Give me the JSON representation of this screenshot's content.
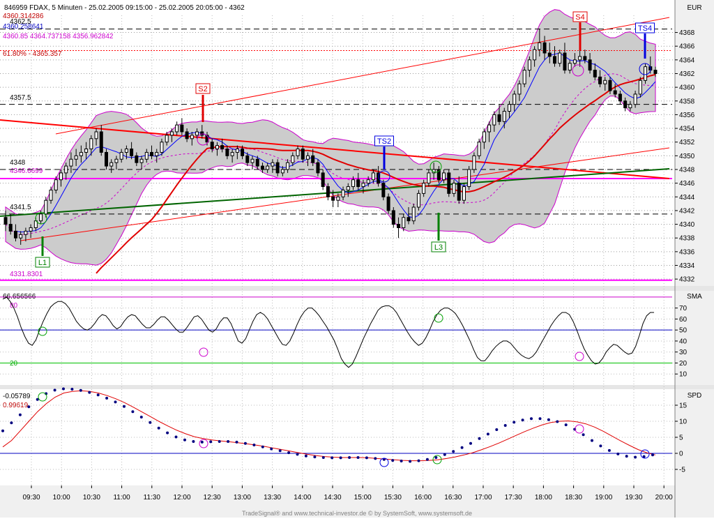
{
  "header": {
    "title": "846959  FDAX, 5 Minuten - 25.02.2005 09:15:00 - 25.02.2005 20:05:00 - 4362",
    "currency": "EUR"
  },
  "colors": {
    "background": "#ffffff",
    "axis_bg": "#f0f0f0",
    "band_fill": "#cccccc",
    "band_line": "#cc00cc",
    "magenta": "#ff00ff",
    "red": "#ff0000",
    "blue": "#0000ff",
    "green": "#006400",
    "navy": "#000080",
    "candle": "#000000"
  },
  "chart_data": [
    {
      "type": "candlestick",
      "panel": "price",
      "y_ticks": [
        4332,
        4334,
        4336,
        4338,
        4340,
        4342,
        4344,
        4346,
        4348,
        4350,
        4352,
        4354,
        4356,
        4358,
        4360,
        4362,
        4364,
        4366,
        4368
      ],
      "ylim": [
        4331.2,
        4370.5
      ],
      "x_ticks": [
        "09:30",
        "10:00",
        "10:30",
        "11:00",
        "11:30",
        "12:00",
        "12:30",
        "13:00",
        "13:30",
        "14:00",
        "14:30",
        "15:00",
        "15:30",
        "16:00",
        "16:30",
        "17:00",
        "17:30",
        "18:00",
        "18:30",
        "19:00",
        "19:30",
        "20:00"
      ],
      "candles": [
        [
          4341.0,
          4342.0,
          4339.0,
          4340.0
        ],
        [
          4340.0,
          4341.5,
          4338.5,
          4339.0
        ],
        [
          4339.0,
          4340.0,
          4337.5,
          4338.0
        ],
        [
          4338.0,
          4339.0,
          4337.0,
          4338.5
        ],
        [
          4338.5,
          4339.5,
          4337.5,
          4339.0
        ],
        [
          4339.0,
          4340.0,
          4338.0,
          4339.5
        ],
        [
          4339.5,
          4341.0,
          4339.0,
          4340.5
        ],
        [
          4340.5,
          4342.0,
          4340.0,
          4341.5
        ],
        [
          4341.5,
          4344.0,
          4341.0,
          4343.5
        ],
        [
          4343.5,
          4345.5,
          4343.0,
          4345.0
        ],
        [
          4345.0,
          4347.0,
          4344.5,
          4346.5
        ],
        [
          4346.5,
          4348.0,
          4345.5,
          4347.5
        ],
        [
          4347.5,
          4349.0,
          4346.5,
          4348.5
        ],
        [
          4348.5,
          4350.5,
          4347.5,
          4349.5
        ],
        [
          4349.5,
          4351.0,
          4348.5,
          4350.0
        ],
        [
          4350.0,
          4351.5,
          4349.0,
          4350.5
        ],
        [
          4350.5,
          4352.0,
          4349.5,
          4351.0
        ],
        [
          4351.0,
          4353.0,
          4350.0,
          4352.5
        ],
        [
          4352.5,
          4354.0,
          4351.5,
          4353.5
        ],
        [
          4353.5,
          4354.5,
          4350.0,
          4350.5
        ],
        [
          4350.5,
          4351.0,
          4348.0,
          4348.5
        ],
        [
          4348.5,
          4349.5,
          4347.5,
          4349.0
        ],
        [
          4349.0,
          4350.0,
          4348.0,
          4349.5
        ],
        [
          4349.5,
          4351.0,
          4349.0,
          4350.5
        ],
        [
          4350.5,
          4351.5,
          4349.5,
          4351.0
        ],
        [
          4351.0,
          4352.0,
          4349.5,
          4350.0
        ],
        [
          4350.0,
          4350.5,
          4348.5,
          4349.0
        ],
        [
          4349.0,
          4350.0,
          4348.0,
          4349.5
        ],
        [
          4349.5,
          4351.0,
          4349.0,
          4350.5
        ],
        [
          4350.5,
          4351.5,
          4349.5,
          4350.0
        ],
        [
          4350.0,
          4351.0,
          4349.0,
          4350.5
        ],
        [
          4350.5,
          4352.5,
          4350.0,
          4352.0
        ],
        [
          4352.0,
          4353.5,
          4351.5,
          4353.0
        ],
        [
          4353.0,
          4354.0,
          4352.0,
          4353.5
        ],
        [
          4353.5,
          4355.0,
          4353.0,
          4354.5
        ],
        [
          4354.5,
          4355.5,
          4353.0,
          4353.5
        ],
        [
          4353.5,
          4354.0,
          4352.0,
          4352.5
        ],
        [
          4352.5,
          4353.5,
          4351.5,
          4353.0
        ],
        [
          4353.0,
          4354.0,
          4352.5,
          4353.5
        ],
        [
          4353.5,
          4354.5,
          4352.5,
          4353.0
        ],
        [
          4353.0,
          4353.5,
          4351.5,
          4352.0
        ],
        [
          4352.0,
          4352.5,
          4350.5,
          4351.0
        ],
        [
          4351.0,
          4352.0,
          4350.0,
          4351.5
        ],
        [
          4351.5,
          4352.5,
          4350.5,
          4351.0
        ],
        [
          4351.0,
          4351.5,
          4349.5,
          4350.0
        ],
        [
          4350.0,
          4351.0,
          4349.0,
          4350.5
        ],
        [
          4350.5,
          4351.5,
          4349.5,
          4351.0
        ],
        [
          4351.0,
          4351.5,
          4349.5,
          4350.0
        ],
        [
          4350.0,
          4350.5,
          4348.5,
          4349.0
        ],
        [
          4349.0,
          4350.0,
          4348.0,
          4349.5
        ],
        [
          4349.5,
          4350.0,
          4348.0,
          4348.5
        ],
        [
          4348.5,
          4349.0,
          4347.5,
          4348.0
        ],
        [
          4348.0,
          4349.0,
          4347.5,
          4348.5
        ],
        [
          4348.5,
          4349.5,
          4347.5,
          4349.0
        ],
        [
          4349.0,
          4349.5,
          4347.0,
          4347.5
        ],
        [
          4347.5,
          4348.5,
          4347.0,
          4348.0
        ],
        [
          4348.0,
          4349.5,
          4347.5,
          4349.0
        ],
        [
          4349.0,
          4350.5,
          4348.5,
          4350.0
        ],
        [
          4350.0,
          4351.5,
          4349.5,
          4351.0
        ],
        [
          4351.0,
          4351.5,
          4349.0,
          4349.5
        ],
        [
          4349.5,
          4350.5,
          4348.5,
          4350.0
        ],
        [
          4350.0,
          4351.0,
          4348.5,
          4349.0
        ],
        [
          4349.0,
          4349.5,
          4347.0,
          4347.5
        ],
        [
          4347.5,
          4348.0,
          4345.0,
          4345.5
        ],
        [
          4345.5,
          4346.0,
          4343.5,
          4344.0
        ],
        [
          4344.0,
          4345.0,
          4342.5,
          4343.5
        ],
        [
          4343.5,
          4344.5,
          4342.5,
          4344.0
        ],
        [
          4344.0,
          4345.5,
          4343.5,
          4345.0
        ],
        [
          4345.0,
          4346.0,
          4344.0,
          4345.5
        ],
        [
          4345.5,
          4347.0,
          4345.0,
          4346.5
        ],
        [
          4346.5,
          4347.5,
          4345.0,
          4345.5
        ],
        [
          4345.5,
          4346.5,
          4344.5,
          4346.0
        ],
        [
          4346.0,
          4347.0,
          4345.5,
          4346.5
        ],
        [
          4346.5,
          4348.0,
          4346.0,
          4347.5
        ],
        [
          4347.5,
          4348.5,
          4345.5,
          4346.0
        ],
        [
          4346.0,
          4346.5,
          4343.5,
          4344.0
        ],
        [
          4344.0,
          4344.5,
          4341.5,
          4342.0
        ],
        [
          4342.0,
          4342.5,
          4339.5,
          4340.0
        ],
        [
          4340.0,
          4341.0,
          4338.0,
          4339.5
        ],
        [
          4339.5,
          4341.5,
          4339.0,
          4341.0
        ],
        [
          4341.0,
          4342.5,
          4340.0,
          4340.5
        ],
        [
          4340.5,
          4343.0,
          4340.0,
          4342.5
        ],
        [
          4342.5,
          4345.0,
          4342.0,
          4344.5
        ],
        [
          4344.5,
          4346.5,
          4344.0,
          4346.0
        ],
        [
          4346.0,
          4348.0,
          4345.5,
          4347.5
        ],
        [
          4347.5,
          4349.0,
          4346.5,
          4348.0
        ],
        [
          4348.0,
          4348.5,
          4346.0,
          4346.5
        ],
        [
          4346.5,
          4348.0,
          4346.0,
          4347.5
        ],
        [
          4347.5,
          4348.0,
          4344.0,
          4344.5
        ],
        [
          4344.5,
          4346.5,
          4344.0,
          4346.0
        ],
        [
          4346.0,
          4347.0,
          4343.0,
          4343.5
        ],
        [
          4343.5,
          4346.0,
          4343.0,
          4345.5
        ],
        [
          4345.5,
          4348.5,
          4345.0,
          4348.0
        ],
        [
          4348.0,
          4350.5,
          4347.5,
          4350.0
        ],
        [
          4350.0,
          4352.5,
          4349.5,
          4352.0
        ],
        [
          4352.0,
          4354.0,
          4351.0,
          4353.5
        ],
        [
          4353.5,
          4355.0,
          4352.0,
          4354.5
        ],
        [
          4354.5,
          4356.5,
          4353.5,
          4356.0
        ],
        [
          4356.0,
          4357.5,
          4354.5,
          4355.0
        ],
        [
          4355.0,
          4357.0,
          4354.0,
          4356.5
        ],
        [
          4356.5,
          4358.0,
          4355.5,
          4357.5
        ],
        [
          4357.5,
          4359.5,
          4356.5,
          4359.0
        ],
        [
          4359.0,
          4361.0,
          4358.0,
          4360.5
        ],
        [
          4360.5,
          4363.0,
          4360.0,
          4362.5
        ],
        [
          4362.5,
          4364.5,
          4361.5,
          4364.0
        ],
        [
          4364.0,
          4366.0,
          4363.0,
          4365.5
        ],
        [
          4365.5,
          4368.5,
          4364.5,
          4366.5
        ],
        [
          4366.5,
          4367.5,
          4364.0,
          4365.0
        ],
        [
          4365.0,
          4366.5,
          4363.5,
          4364.5
        ],
        [
          4364.5,
          4366.0,
          4363.0,
          4363.5
        ],
        [
          4363.5,
          4365.5,
          4363.0,
          4365.0
        ],
        [
          4365.0,
          4366.5,
          4362.0,
          4362.5
        ],
        [
          4362.5,
          4364.0,
          4362.0,
          4363.5
        ],
        [
          4363.5,
          4365.0,
          4363.0,
          4364.0
        ],
        [
          4364.0,
          4366.0,
          4363.0,
          4364.5
        ],
        [
          4364.5,
          4365.5,
          4363.5,
          4364.0
        ],
        [
          4364.0,
          4365.0,
          4362.0,
          4362.5
        ],
        [
          4362.5,
          4363.5,
          4361.0,
          4361.5
        ],
        [
          4361.5,
          4362.5,
          4360.0,
          4360.5
        ],
        [
          4360.5,
          4361.5,
          4359.5,
          4361.0
        ],
        [
          4361.0,
          4361.5,
          4359.0,
          4359.5
        ],
        [
          4359.5,
          4360.5,
          4358.5,
          4359.0
        ],
        [
          4359.0,
          4359.5,
          4357.5,
          4358.0
        ],
        [
          4358.0,
          4358.5,
          4356.5,
          4357.0
        ],
        [
          4357.0,
          4358.0,
          4356.5,
          4357.5
        ],
        [
          4357.5,
          4359.5,
          4357.0,
          4359.0
        ],
        [
          4359.0,
          4361.5,
          4358.5,
          4361.0
        ],
        [
          4361.0,
          4363.5,
          4360.5,
          4363.0
        ],
        [
          4363.0,
          4364.5,
          4362.0,
          4362.5
        ],
        [
          4362.5,
          4363.0,
          4361.5,
          4362.0
        ]
      ],
      "annotations": {
        "top_labels": [
          "4360.314286",
          "4362.5",
          "4360.258641"
        ],
        "magenta_info": "4360.85 4364.737158 4356.962842",
        "fib": "61.80% - 4365.357",
        "level_4357": "4357.5",
        "level_4348": "4348",
        "level_4346": "4346.6699",
        "level_4341": "4341.5",
        "level_4331": "4331.8301"
      },
      "signals": {
        "S2": "S2",
        "S4": "S4",
        "TS2": "TS2",
        "TS4": "TS4",
        "L1": "L1",
        "L3": "L3"
      }
    },
    {
      "type": "line",
      "panel": "SMA",
      "name": "SMA",
      "value_label": "66.656566",
      "ylim": [
        0,
        85
      ],
      "y_ticks": [
        10,
        20,
        30,
        40,
        50,
        60,
        70
      ],
      "level_labels": {
        "upper": "80",
        "lower": "20"
      },
      "levels": [
        80,
        50,
        20
      ],
      "values": [
        78,
        80,
        76,
        70,
        62,
        52,
        44,
        38,
        36,
        41,
        50,
        58,
        65,
        71,
        74,
        76,
        76,
        74,
        70,
        64,
        58,
        54,
        51,
        50,
        52,
        56,
        61,
        64,
        63,
        59,
        54,
        51,
        53,
        58,
        62,
        64,
        63,
        59,
        55,
        52,
        52,
        55,
        59,
        62,
        62,
        59,
        55,
        51,
        48,
        48,
        52,
        57,
        62,
        63,
        60,
        55,
        50,
        48,
        51,
        57,
        61,
        61,
        56,
        48,
        40,
        38,
        42,
        50,
        58,
        64,
        66,
        64,
        60,
        54,
        48,
        42,
        37,
        36,
        40,
        47,
        55,
        62,
        67,
        70,
        70,
        67,
        63,
        58,
        53,
        47,
        41,
        33,
        24,
        19,
        16,
        19,
        26,
        34,
        42,
        49,
        56,
        62,
        68,
        71,
        72,
        72,
        70,
        66,
        60,
        54,
        48,
        43,
        39,
        36,
        38,
        43,
        50,
        58,
        64,
        68,
        70,
        70,
        68,
        65,
        60,
        54,
        47,
        40,
        32,
        25,
        22,
        22,
        26,
        31,
        35,
        38,
        40,
        40,
        38,
        34,
        30,
        27,
        25,
        24,
        26,
        30,
        36,
        42,
        48,
        54,
        59,
        63,
        66,
        66,
        64,
        58,
        50,
        41,
        33,
        27,
        22,
        19,
        20,
        24,
        30,
        34,
        37,
        36,
        33,
        30,
        28,
        29,
        35,
        45,
        56,
        63,
        66,
        66
      ],
      "circles": [
        "green",
        "magenta",
        "green",
        "magenta"
      ]
    },
    {
      "type": "line",
      "panel": "SPD",
      "name": "SPD",
      "value_labels": [
        "-0.05789",
        "0.99619"
      ],
      "ylim": [
        -10,
        20
      ],
      "y_ticks": [
        -5,
        0,
        5,
        10,
        15
      ],
      "red_line": [
        2,
        4,
        7,
        10,
        13,
        15.5,
        17.5,
        18.8,
        19.3,
        19.5,
        19.3,
        18.8,
        18.0,
        17.0,
        15.8,
        14.4,
        12.9,
        11.4,
        9.9,
        8.5,
        7.2,
        6.1,
        5.2,
        4.6,
        4.2,
        3.9,
        3.6,
        3.3,
        3.0,
        2.6,
        2.2,
        1.7,
        1.2,
        0.7,
        0.2,
        -0.3,
        -0.7,
        -1.0,
        -1.2,
        -1.3,
        -1.3,
        -1.3,
        -1.4,
        -1.6,
        -1.8,
        -2.0,
        -2.2,
        -2.3,
        -2.3,
        -2.2,
        -2.0,
        -1.6,
        -1.1,
        -0.5,
        0.2,
        1.1,
        2.1,
        3.2,
        4.4,
        5.6,
        6.8,
        7.9,
        8.9,
        9.6,
        10.0,
        10.1,
        9.8,
        9.2,
        8.2,
        6.9,
        5.4,
        3.9,
        2.5,
        1.2,
        0.2,
        -0.5
      ],
      "dot_line": [
        7,
        9.5,
        12,
        14.5,
        16.8,
        18.6,
        19.7,
        20.1,
        20.0,
        19.6,
        19.0,
        18.2,
        17.2,
        16.0,
        14.6,
        13.0,
        11.3,
        9.6,
        7.9,
        6.4,
        5.1,
        4.2,
        3.7,
        3.5,
        3.6,
        3.7,
        3.7,
        3.5,
        3.1,
        2.6,
        2.0,
        1.4,
        0.8,
        0.2,
        -0.3,
        -0.8,
        -1.1,
        -1.3,
        -1.4,
        -1.4,
        -1.3,
        -1.3,
        -1.4,
        -1.6,
        -1.9,
        -2.2,
        -2.4,
        -2.5,
        -2.3,
        -1.9,
        -1.3,
        -0.4,
        0.6,
        1.8,
        3.1,
        4.6,
        6.0,
        7.4,
        8.7,
        9.7,
        10.4,
        10.8,
        10.8,
        10.5,
        9.9,
        8.9,
        7.5,
        5.8,
        4.0,
        2.3,
        0.9,
        -0.2,
        -0.9,
        -1.2,
        -1.0,
        -0.5
      ]
    }
  ],
  "footer": {
    "credit": "TradeSignal® and www.technical-investor.de © by SystemSoft, www.systemsoft.de"
  }
}
